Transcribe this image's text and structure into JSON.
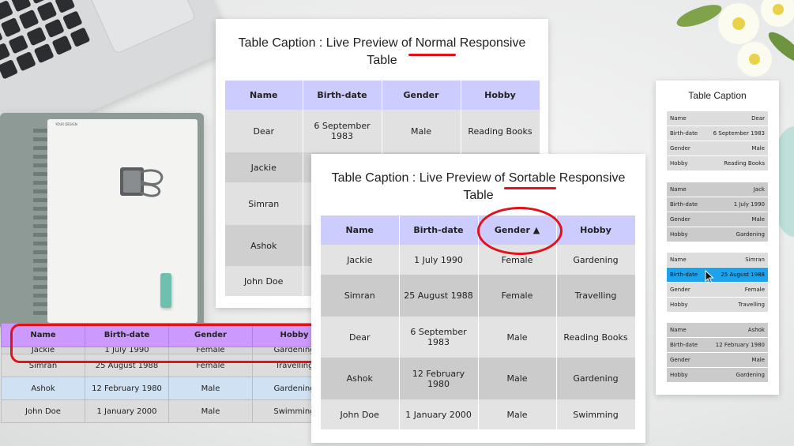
{
  "normal": {
    "caption_prefix": "Table Caption : Live Preview of ",
    "caption_emph": "Normal",
    "caption_suffix": " Responsive",
    "caption_line2": "Table",
    "headers": [
      "Name",
      "Birth-date",
      "Gender",
      "Hobby"
    ],
    "rows": [
      [
        "Dear",
        "6 September 1983",
        "Male",
        "Reading Books"
      ],
      [
        "Jackie",
        "",
        "",
        ""
      ],
      [
        "Simran",
        "",
        "",
        ""
      ],
      [
        "Ashok",
        "",
        "",
        ""
      ],
      [
        "John Doe",
        "",
        "",
        ""
      ]
    ]
  },
  "sortable": {
    "caption_prefix": "Table Caption : Live Preview of ",
    "caption_emph": "Sortable",
    "caption_suffix": " Responsive",
    "caption_line2": "Table",
    "headers": [
      "Name",
      "Birth-date",
      "Gender ▲",
      "Hobby"
    ],
    "rows": [
      [
        "Jackie",
        "1 July 1990",
        "Female",
        "Gardening"
      ],
      [
        "Simran",
        "25 August 1988",
        "Female",
        "Travelling"
      ],
      [
        "Dear",
        "6 September 1983",
        "Male",
        "Reading Books"
      ],
      [
        "Ashok",
        "12 February 1980",
        "Male",
        "Gardening"
      ],
      [
        "John Doe",
        "1 January 2000",
        "Male",
        "Swimming"
      ]
    ]
  },
  "sticky": {
    "headers": [
      "Name",
      "Birth-date",
      "Gender",
      "Hobby"
    ],
    "partial_row": [
      "Jackie",
      "1 July 1990",
      "Female",
      "Gardening"
    ],
    "rows": [
      [
        "Simran",
        "25 August 1988",
        "Female",
        "Travelling"
      ],
      [
        "Ashok",
        "12 February 1980",
        "Male",
        "Gardening"
      ],
      [
        "John Doe",
        "1 January 2000",
        "Male",
        "Swimming"
      ]
    ]
  },
  "stacked": {
    "caption": "Table Caption",
    "cards": [
      {
        "rows": [
          [
            "Name",
            "Dear"
          ],
          [
            "Birth-date",
            "6 September 1983"
          ],
          [
            "Gender",
            "Male"
          ],
          [
            "Hobby",
            "Reading Books"
          ]
        ]
      },
      {
        "rows": [
          [
            "Name",
            "Jack"
          ],
          [
            "Birth-date",
            "1 July 1990"
          ],
          [
            "Gender",
            "Male"
          ],
          [
            "Hobby",
            "Gardening"
          ]
        ]
      },
      {
        "rows": [
          [
            "Name",
            "Simran"
          ],
          [
            "Birth-date",
            "25 August 1988"
          ],
          [
            "Gender",
            "Female"
          ],
          [
            "Hobby",
            "Travelling"
          ]
        ]
      },
      {
        "rows": [
          [
            "Name",
            "Ashok"
          ],
          [
            "Birth-date",
            "12 February 1980"
          ],
          [
            "Gender",
            "Male"
          ],
          [
            "Hobby",
            "Gardening"
          ]
        ]
      }
    ]
  },
  "notebook": {
    "brand": "YOUR DESIGN"
  },
  "colors": {
    "header_blue": "#ccccff",
    "header_purple": "#cc99ff",
    "highlight": "#1ea2ea",
    "annotation_red": "#e0121b"
  }
}
